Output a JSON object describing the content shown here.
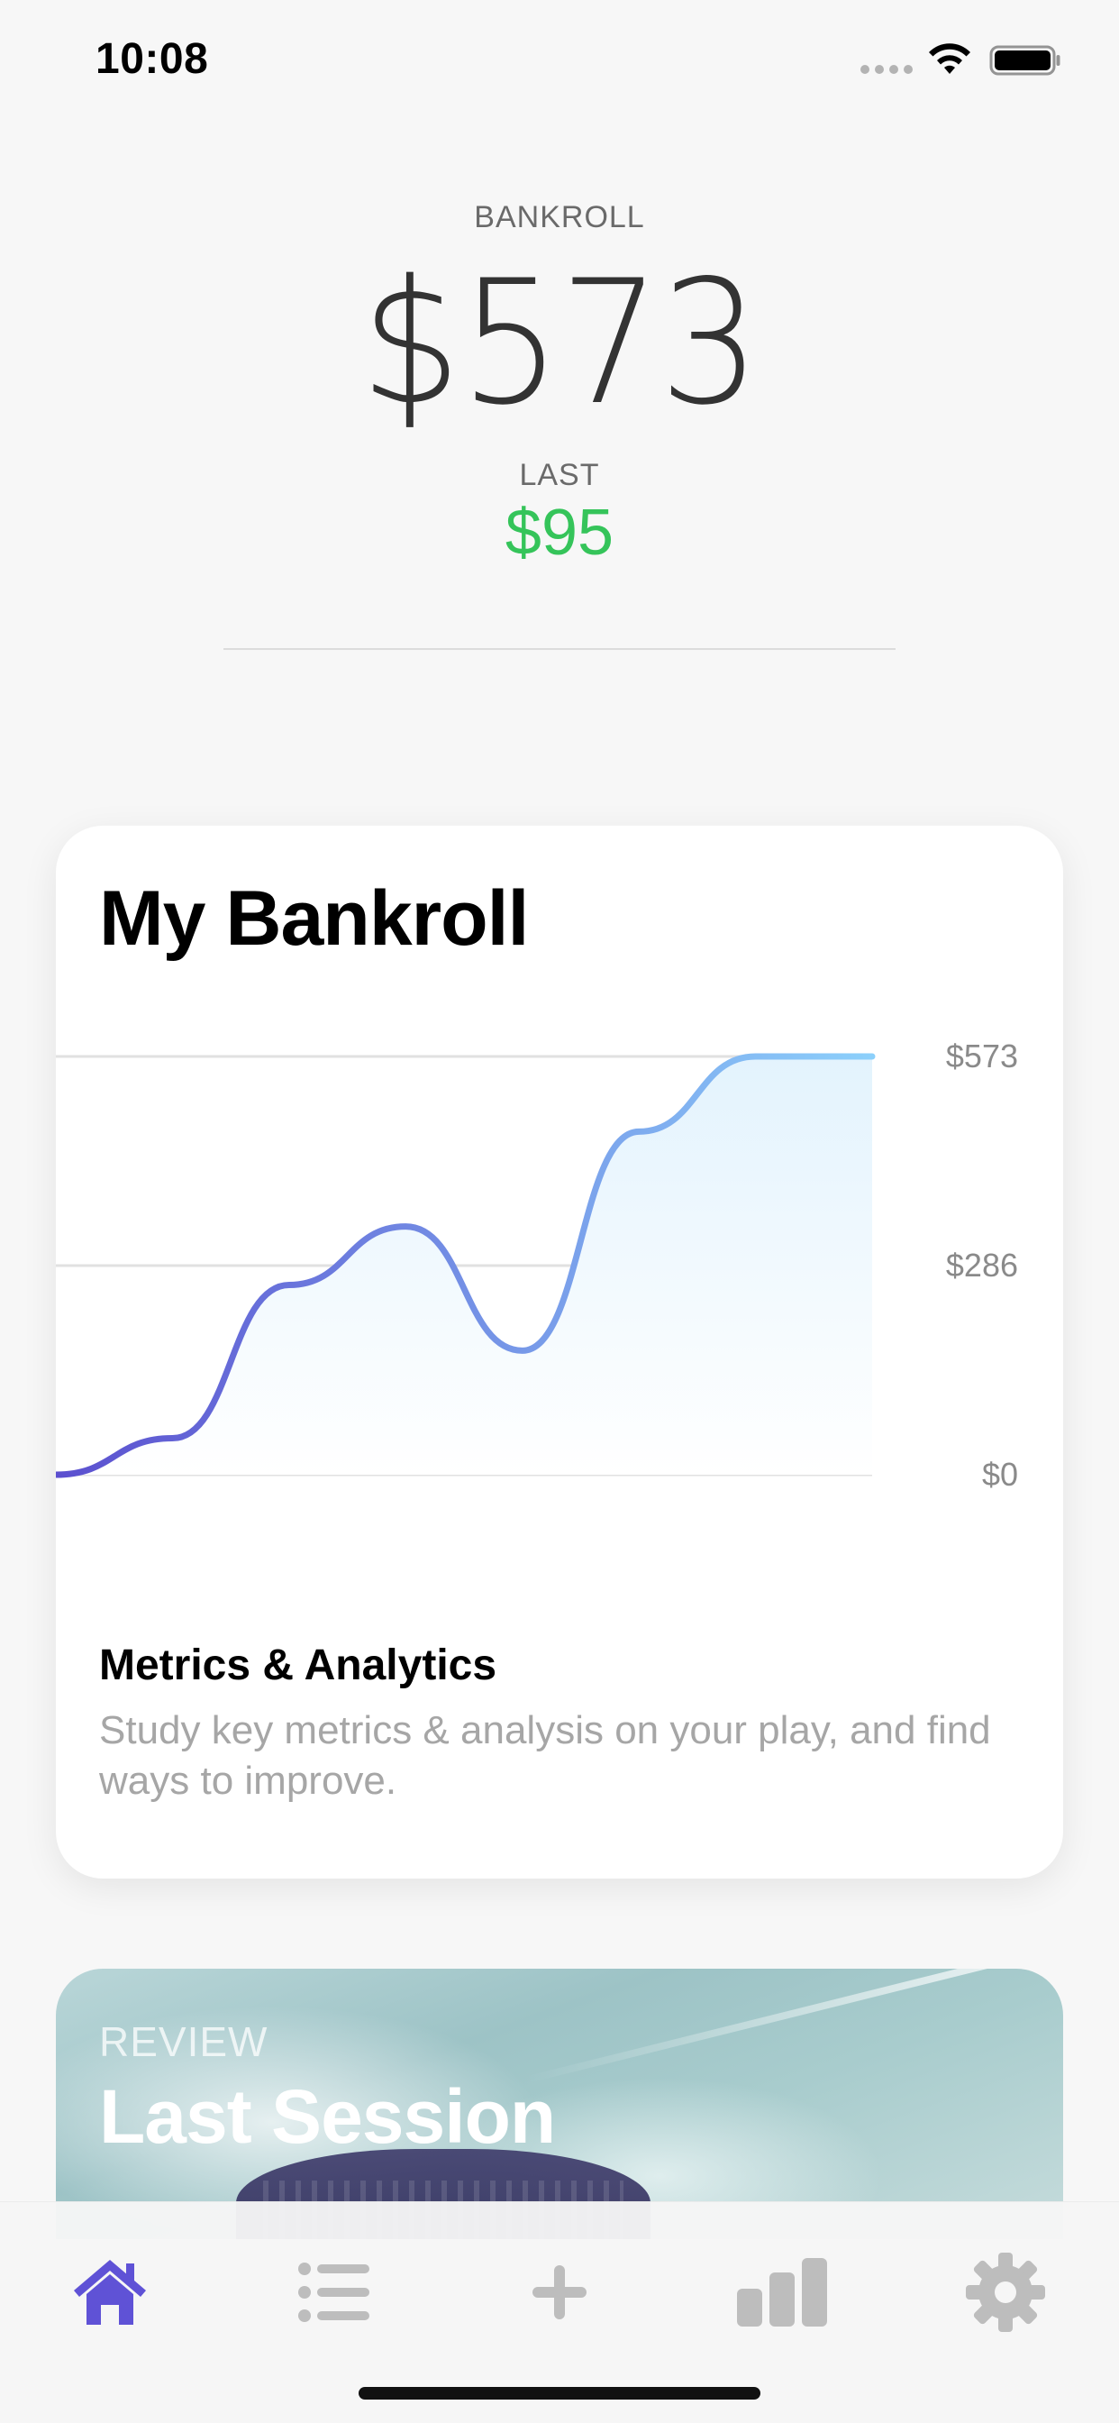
{
  "status_bar": {
    "time": "10:08",
    "icons": [
      "cellular-signal-icon",
      "wifi-icon",
      "battery-icon"
    ]
  },
  "header": {
    "bankroll_label": "BANKROLL",
    "bankroll_value": "$573",
    "last_label": "LAST",
    "last_value": "$95",
    "last_color": "#35c45a"
  },
  "bankroll_card": {
    "title": "My Bankroll",
    "subtitle": "Metrics & Analytics",
    "description": "Study key metrics & analysis on your play, and find ways to improve."
  },
  "chart_data": {
    "type": "area",
    "title": "",
    "x": [
      0,
      1,
      2,
      3,
      4,
      5,
      6,
      7
    ],
    "values": [
      0,
      50,
      260,
      340,
      170,
      470,
      573,
      573
    ],
    "ylim": [
      0,
      573
    ],
    "y_ticks": [
      "$573",
      "$286",
      "$0"
    ],
    "grid": true,
    "colors": {
      "line_start": "#5b4fcf",
      "line_end": "#8cd0fb",
      "fill": "#e3f3fd"
    }
  },
  "review_card": {
    "label": "REVIEW",
    "title": "Last Session"
  },
  "tab_bar": {
    "active_color": "#5f52d6",
    "inactive_color": "#bdbdbd",
    "tabs": [
      {
        "icon": "home-icon",
        "active": true
      },
      {
        "icon": "list-icon",
        "active": false
      },
      {
        "icon": "plus-icon",
        "active": false
      },
      {
        "icon": "bar-chart-icon",
        "active": false
      },
      {
        "icon": "gear-icon",
        "active": false
      }
    ]
  }
}
